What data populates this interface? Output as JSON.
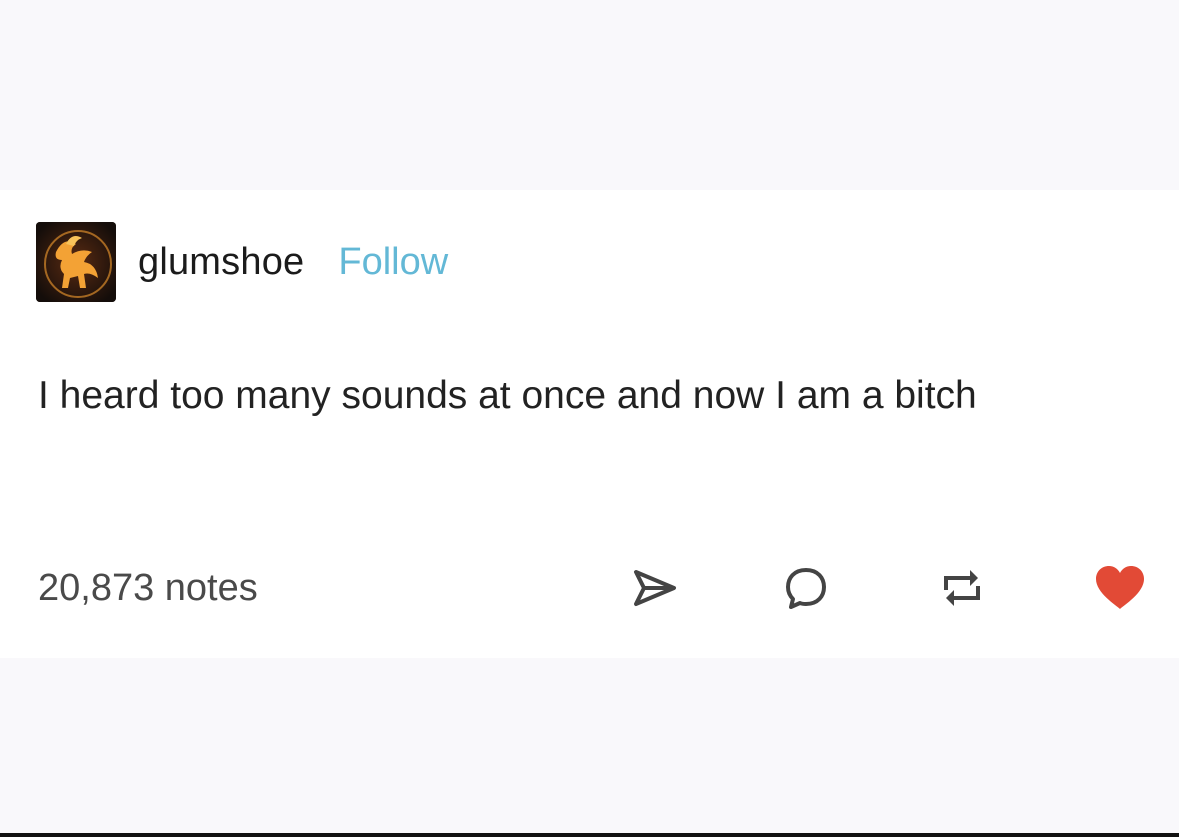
{
  "post": {
    "author": {
      "username": "glumshoe",
      "avatar_icon": "griffin-avatar-icon"
    },
    "follow_label": "Follow",
    "text": "I heard too many sounds at once and now I am a bitch",
    "notes": "20,873 notes",
    "actions": [
      {
        "name": "share",
        "icon": "share-arrow-icon"
      },
      {
        "name": "reply",
        "icon": "speech-bubble-icon"
      },
      {
        "name": "reblog",
        "icon": "reblog-icon"
      },
      {
        "name": "like",
        "icon": "heart-icon",
        "liked": true
      }
    ]
  },
  "colors": {
    "follow": "#63b8d6",
    "heart": "#e24a36",
    "text": "#222222",
    "muted": "#4a4a4a",
    "background": "#f9f8fb"
  }
}
